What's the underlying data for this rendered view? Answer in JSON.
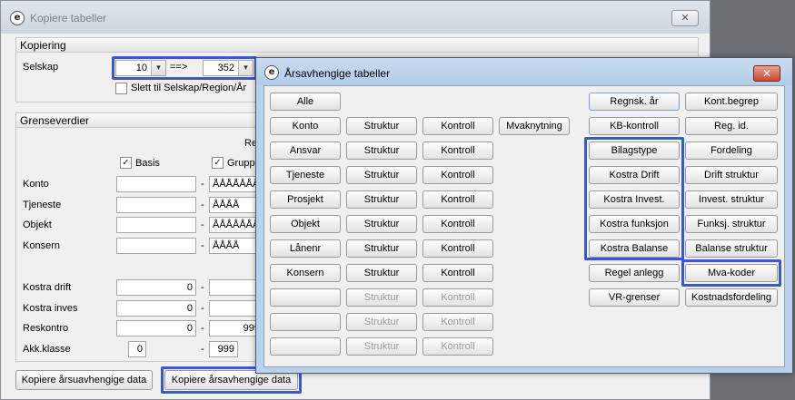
{
  "back_window": {
    "title": "Kopiere tabeller",
    "close_glyph": "✕",
    "kopiering": {
      "header": "Kopiering",
      "selskap_label": "Selskap",
      "from_value": "10",
      "arrow_text": "==>",
      "to_value": "352",
      "slett_label": "Slett til Selskap/Region/År"
    },
    "grenseverdier": {
      "header": "Grenseverdier",
      "partial_col_header": "Re",
      "basis_label": "Basis",
      "gruppe_label": "Gruppe",
      "rows": [
        {
          "label": "Konto",
          "from": "",
          "to": "ÅÅÅÅÅÅÅÅ"
        },
        {
          "label": "Tjeneste",
          "from": "",
          "to": "ÅÅÅÅ"
        },
        {
          "label": "Objekt",
          "from": "",
          "to": "ÅÅÅÅÅÅÅÅ"
        },
        {
          "label": "Konsern",
          "from": "",
          "to": "ÅÅÅÅ"
        },
        {
          "label": "Kostra drift",
          "from": "0",
          "to": ""
        },
        {
          "label": "Kostra inves",
          "from": "0",
          "to": ""
        },
        {
          "label": "Reskontro",
          "from": "0",
          "to": "999"
        },
        {
          "label": "Akk.klasse",
          "from": "0",
          "to": "999"
        }
      ]
    },
    "buttons": {
      "copy_independent": "Kopiere årsuavhengige data",
      "copy_dependent": "Kopiere årsavhengige data"
    }
  },
  "dialog": {
    "title": "Årsavhengige tabeller",
    "close_glyph": "✕",
    "left_buttons": {
      "alle": "Alle",
      "rows": [
        {
          "main": "Konto",
          "struktur": "Struktur",
          "kontroll": "Kontroll",
          "extra": "Mvaknytning"
        },
        {
          "main": "Ansvar",
          "struktur": "Struktur",
          "kontroll": "Kontroll"
        },
        {
          "main": "Tjeneste",
          "struktur": "Struktur",
          "kontroll": "Kontroll"
        },
        {
          "main": "Prosjekt",
          "struktur": "Struktur",
          "kontroll": "Kontroll"
        },
        {
          "main": "Objekt",
          "struktur": "Struktur",
          "kontroll": "Kontroll"
        },
        {
          "main": "Lånenr",
          "struktur": "Struktur",
          "kontroll": "Kontroll"
        },
        {
          "main": "Konsern",
          "struktur": "Struktur",
          "kontroll": "Kontroll"
        },
        {
          "main": "",
          "struktur": "Struktur",
          "kontroll": "Kontroll"
        },
        {
          "main": "",
          "struktur": "Struktur",
          "kontroll": "Kontroll"
        },
        {
          "main": "",
          "struktur": "Struktur",
          "kontroll": "Kontroll"
        }
      ]
    },
    "right_col1": [
      "Regnsk. år",
      "KB-kontroll",
      "Bilagstype",
      "Kostra Drift",
      "Kostra Invest.",
      "Kostra funksjon",
      "Kostra Balanse",
      "Regel anlegg",
      "VR-grenser"
    ],
    "right_col2": [
      "Kont.begrep",
      "Reg. id.",
      "Fordeling",
      "Drift struktur",
      "Invest. struktur",
      "Funksj. struktur",
      "Balanse struktur",
      "Mva-koder",
      "Kostnadsfordeling"
    ]
  },
  "colors": {
    "highlight": "#3b57d4",
    "dialog_frame": "#b9d1ea",
    "close_red": "#c74c33"
  }
}
